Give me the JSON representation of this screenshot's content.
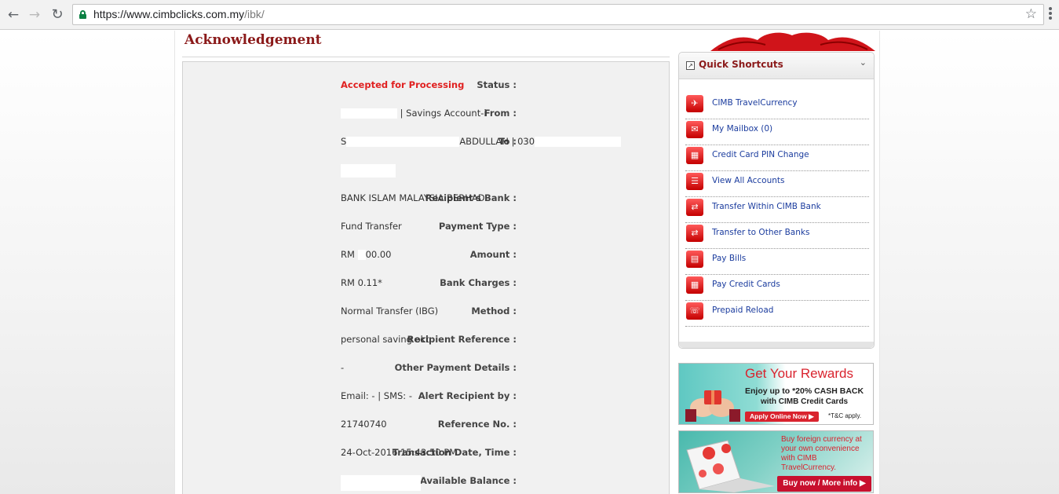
{
  "browser": {
    "url_host": "https://www.cimbclicks.com.my",
    "url_path": "/ibk/"
  },
  "page": {
    "title": "Acknowledgement"
  },
  "details": [
    {
      "label": "Status :",
      "value": "Accepted for Processing"
    },
    {
      "label": "From :",
      "value": "| Savings Account-i"
    },
    {
      "label": "To :",
      "value_prefix": "S",
      "value_mid": "ABDULLAH | 030"
    },
    {
      "label": "Recipient's Bank :",
      "value": "BANK ISLAM MALAYSIA BERHAD"
    },
    {
      "label": "Payment Type :",
      "value": "Fund Transfer"
    },
    {
      "label": "Amount :",
      "value_prefix": "RM",
      "value": "00.00"
    },
    {
      "label": "Bank Charges :",
      "value": "RM 0.11*"
    },
    {
      "label": "Method :",
      "value": "Normal Transfer (IBG)"
    },
    {
      "label": "Recipient Reference :",
      "value": "personal saving okt"
    },
    {
      "label": "Other Payment Details :",
      "value": "-"
    },
    {
      "label": "Alert Recipient by :",
      "value": "Email: - | SMS: -"
    },
    {
      "label": "Reference No. :",
      "value": "21740740"
    },
    {
      "label": "Transaction Date, Time :",
      "value": "24-Oct-2016 15:43:50 PM"
    },
    {
      "label": "Available Balance :",
      "value": ""
    }
  ],
  "shortcuts": {
    "title": "Quick Shortcuts",
    "items": [
      {
        "label": "CIMB TravelCurrency",
        "icon": "plane-icon"
      },
      {
        "label": "My Mailbox  (0)",
        "icon": "mail-icon"
      },
      {
        "label": "Credit Card PIN Change",
        "icon": "card-icon"
      },
      {
        "label": "View All Accounts",
        "icon": "list-icon"
      },
      {
        "label": "Transfer Within CIMB Bank",
        "icon": "transfer-icon"
      },
      {
        "label": "Transfer to Other Banks",
        "icon": "transfer-icon"
      },
      {
        "label": "Pay Bills",
        "icon": "bill-icon"
      },
      {
        "label": "Pay Credit Cards",
        "icon": "card-icon"
      },
      {
        "label": "Prepaid Reload",
        "icon": "phone-icon"
      }
    ]
  },
  "banners": {
    "rewards": {
      "title": "Get Your Rewards",
      "line1": "Enjoy up to *20% CASH BACK",
      "line2": "with CIMB Credit Cards",
      "button": "Apply Online Now ▶",
      "tnc": "*T&C apply."
    },
    "travel": {
      "text": "Buy foreign currency at your own convenience with CIMB TravelCurrency.",
      "button": "Buy now / More info ▶"
    }
  },
  "colors": {
    "brand_red": "#8b1a1a",
    "status_red": "#e02020",
    "link_blue": "#1b3c9e"
  }
}
